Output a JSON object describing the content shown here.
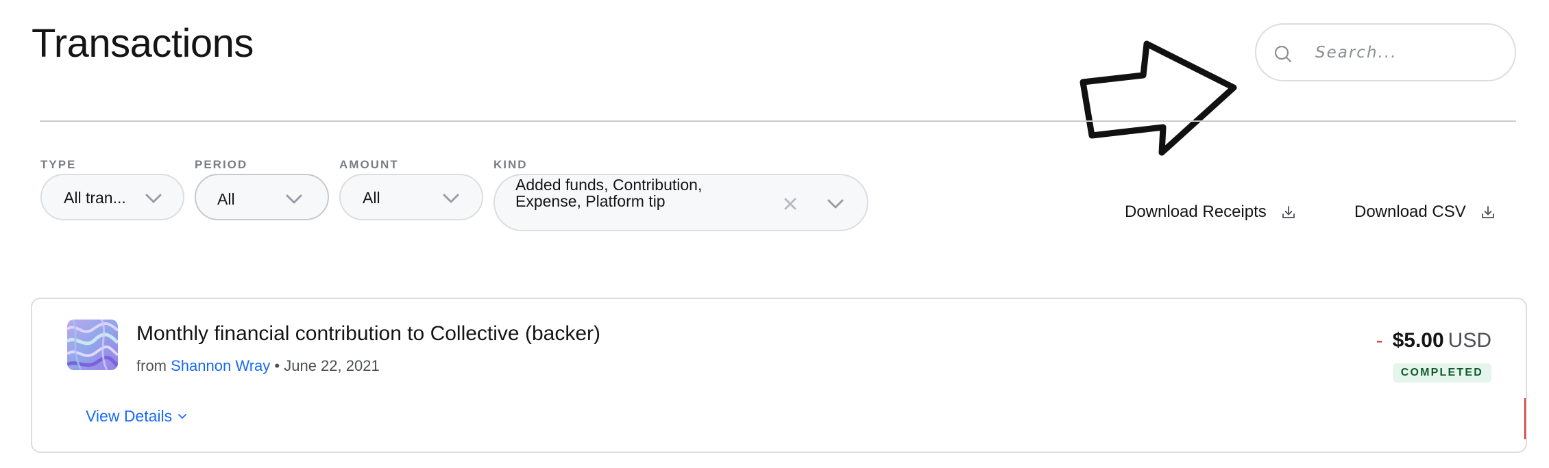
{
  "page": {
    "title": "Transactions"
  },
  "search": {
    "placeholder": "Search...",
    "icon": "search-icon"
  },
  "annotation": {
    "icon": "arrow-callout-icon"
  },
  "filters": {
    "type": {
      "label": "TYPE",
      "value": "All tran..."
    },
    "period": {
      "label": "PERIOD",
      "value": "All"
    },
    "amount": {
      "label": "AMOUNT",
      "value": "All"
    },
    "kind": {
      "label": "KIND",
      "value_line1": "Added funds, Contribution,",
      "value_line2": "Expense, Platform tip"
    }
  },
  "actions": {
    "download_receipts": "Download Receipts",
    "download_csv": "Download CSV"
  },
  "transactions": [
    {
      "title": "Monthly financial contribution to Collective (backer)",
      "from_prefix": "from",
      "from_name": "Shannon Wray",
      "separator": "•",
      "date": "June 22, 2021",
      "amount_sign": "-",
      "amount": "$5.00",
      "currency": "USD",
      "status": "COMPLETED",
      "details_label": "View Details"
    }
  ],
  "colors": {
    "accent": "#1869f5",
    "negative": "#e03131",
    "status_bg": "#e6f5ec",
    "status_text": "#0d5a2c"
  }
}
